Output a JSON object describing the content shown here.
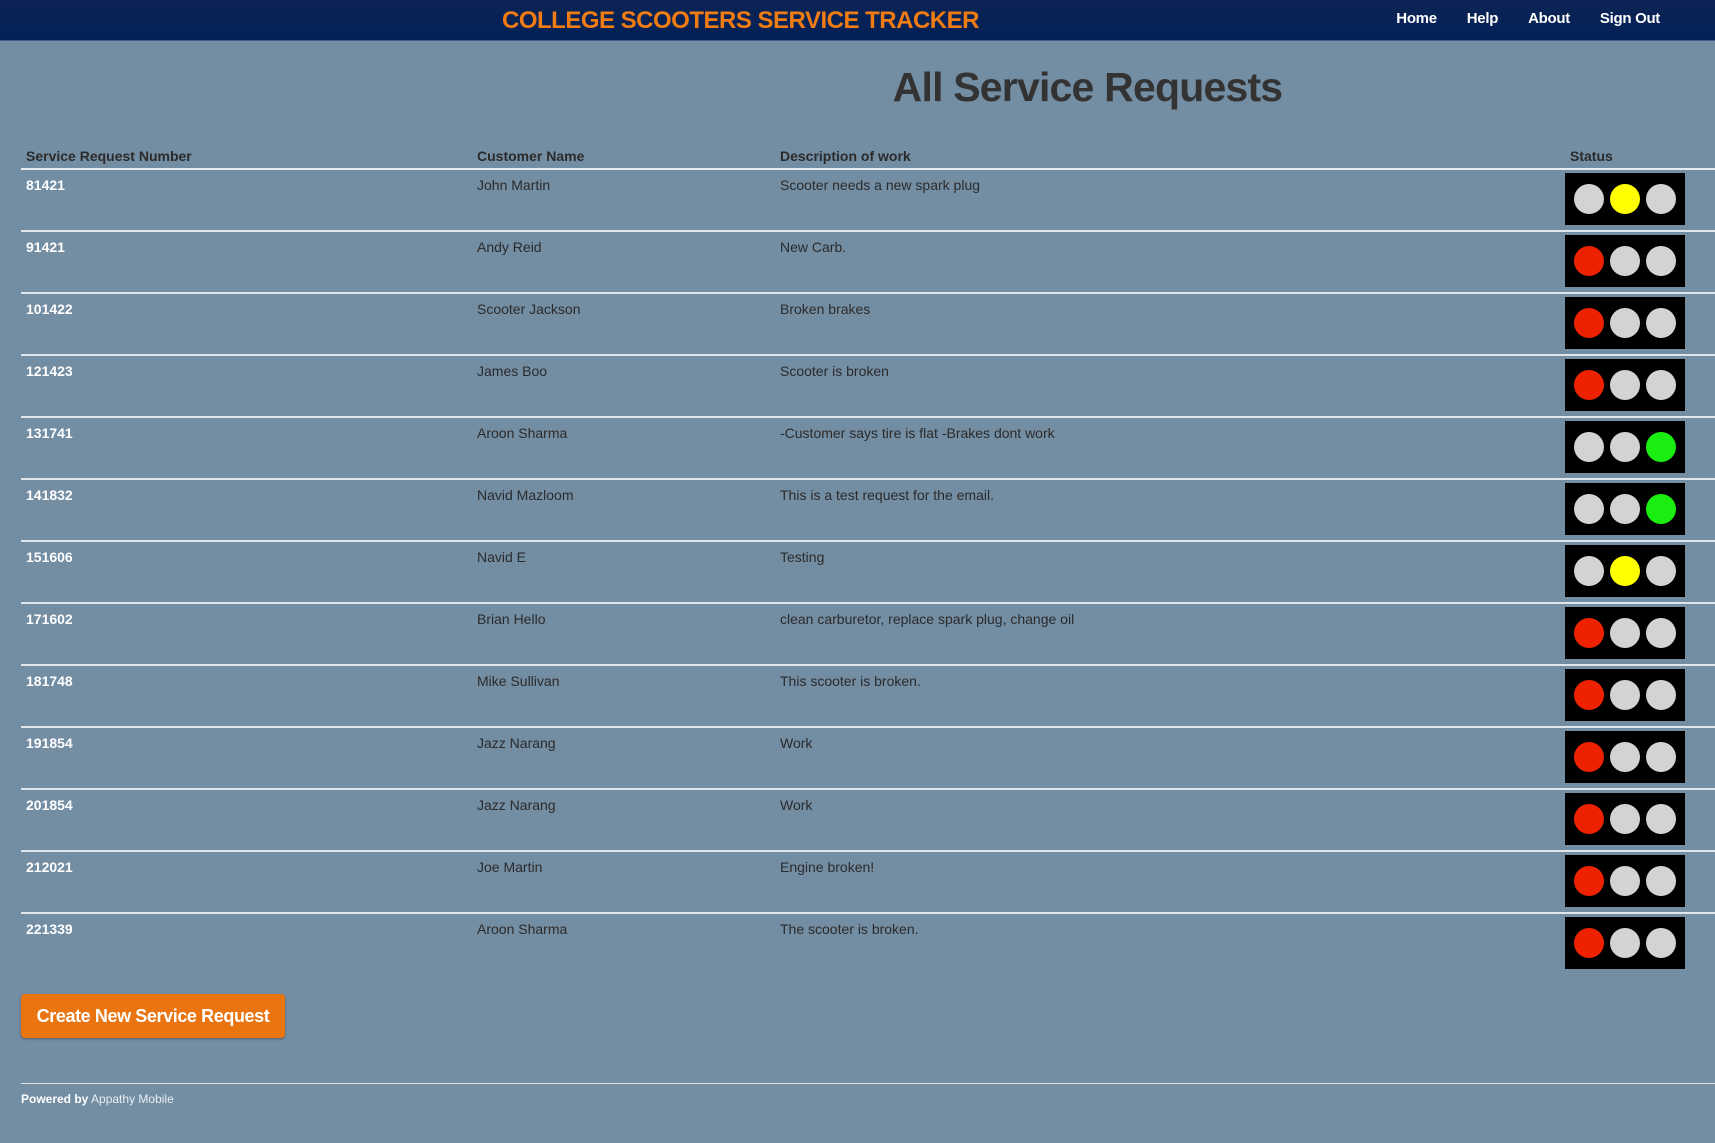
{
  "header": {
    "brand": "COLLEGE SCOOTERS SERVICE TRACKER",
    "nav": [
      "Home",
      "Help",
      "About",
      "Sign Out"
    ]
  },
  "page_title": "All Service Requests",
  "table": {
    "columns": [
      "Service Request Number",
      "Customer Name",
      "Description of work",
      "Status"
    ],
    "rows": [
      {
        "number": "81421",
        "customer": "John Martin",
        "description": "Scooter needs a new spark plug",
        "status": "yellow"
      },
      {
        "number": "91421",
        "customer": "Andy Reid",
        "description": "New Carb.",
        "status": "red"
      },
      {
        "number": "101422",
        "customer": "Scooter Jackson",
        "description": "Broken brakes",
        "status": "red"
      },
      {
        "number": "121423",
        "customer": "James Boo",
        "description": "Scooter is broken",
        "status": "red"
      },
      {
        "number": "131741",
        "customer": "Aroon Sharma",
        "description": "-Customer says tire is flat -Brakes dont work",
        "status": "green"
      },
      {
        "number": "141832",
        "customer": "Navid Mazloom",
        "description": "This is a test request for the email.",
        "status": "green"
      },
      {
        "number": "151606",
        "customer": "Navid E",
        "description": "Testing",
        "status": "yellow"
      },
      {
        "number": "171602",
        "customer": "Brian Hello",
        "description": "clean carburetor, replace spark plug, change oil",
        "status": "red"
      },
      {
        "number": "181748",
        "customer": "Mike Sullivan",
        "description": "This scooter is broken.",
        "status": "red"
      },
      {
        "number": "191854",
        "customer": "Jazz Narang",
        "description": "Work",
        "status": "red"
      },
      {
        "number": "201854",
        "customer": "Jazz Narang",
        "description": "Work",
        "status": "red"
      },
      {
        "number": "212021",
        "customer": "Joe Martin",
        "description": "Engine broken!",
        "status": "red"
      },
      {
        "number": "221339",
        "customer": "Aroon Sharma",
        "description": "The scooter is broken.",
        "status": "red"
      }
    ]
  },
  "create_button": "Create New Service Request",
  "footer": {
    "powered_by": "Powered by",
    "company": "Appathy Mobile"
  },
  "colors": {
    "background": "#738da3",
    "topbar": "#022056",
    "brand": "#f07c13",
    "button": "#ea7510",
    "light_red": "#ee2200",
    "light_yellow": "#ffff00",
    "light_green": "#1aee10",
    "light_off": "#d3d3d3"
  }
}
